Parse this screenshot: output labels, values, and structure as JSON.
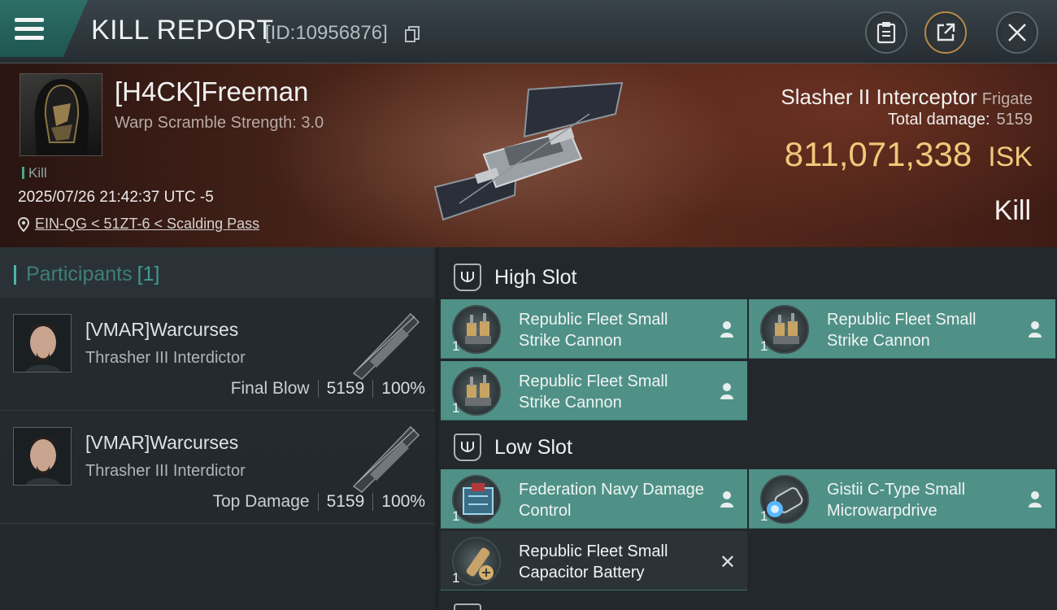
{
  "header": {
    "title": "KILL REPORT",
    "report_id": "[ID:10956876]"
  },
  "victim": {
    "name": "[H4CK]Freeman",
    "warp_scramble": "Warp Scramble Strength: 3.0",
    "kill_tag": "Kill",
    "time": "2025/07/26 21:42:37 UTC -5",
    "location": "EIN-QG < 51ZT-6 < Scalding Pass",
    "ship_name": "Slasher II Interceptor",
    "ship_class": "Frigate",
    "total_damage_label": "Total damage:",
    "total_damage": "5159",
    "isk_value": "811,071,338",
    "isk_unit": "ISK",
    "result": "Kill"
  },
  "participants": {
    "label": "Participants",
    "count": "[1]",
    "rows": [
      {
        "name": "[VMAR]Warcurses",
        "ship": "Thrasher III Interdictor",
        "role": "Final Blow",
        "damage": "5159",
        "percent": "100%"
      },
      {
        "name": "[VMAR]Warcurses",
        "ship": "Thrasher III Interdictor",
        "role": "Top Damage",
        "damage": "5159",
        "percent": "100%"
      }
    ]
  },
  "fitting": {
    "high_slot_label": "High Slot",
    "low_slot_label": "Low Slot",
    "high": [
      {
        "name": "Republic Fleet Small Strike Cannon",
        "qty": "1"
      },
      {
        "name": "Republic Fleet Small Strike Cannon",
        "qty": "1"
      },
      {
        "name": "Republic Fleet Small Strike Cannon",
        "qty": "1"
      }
    ],
    "low": [
      {
        "name": "Federation Navy Damage Control",
        "qty": "1"
      },
      {
        "name": "Gistii C-Type Small Microwarpdrive",
        "qty": "1"
      },
      {
        "name": "Republic Fleet Small Capacitor Battery",
        "qty": "1"
      }
    ]
  },
  "colors": {
    "accent_teal": "#4f9186",
    "isk_gold": "#f0c87a",
    "share_ring": "#b88a45"
  }
}
